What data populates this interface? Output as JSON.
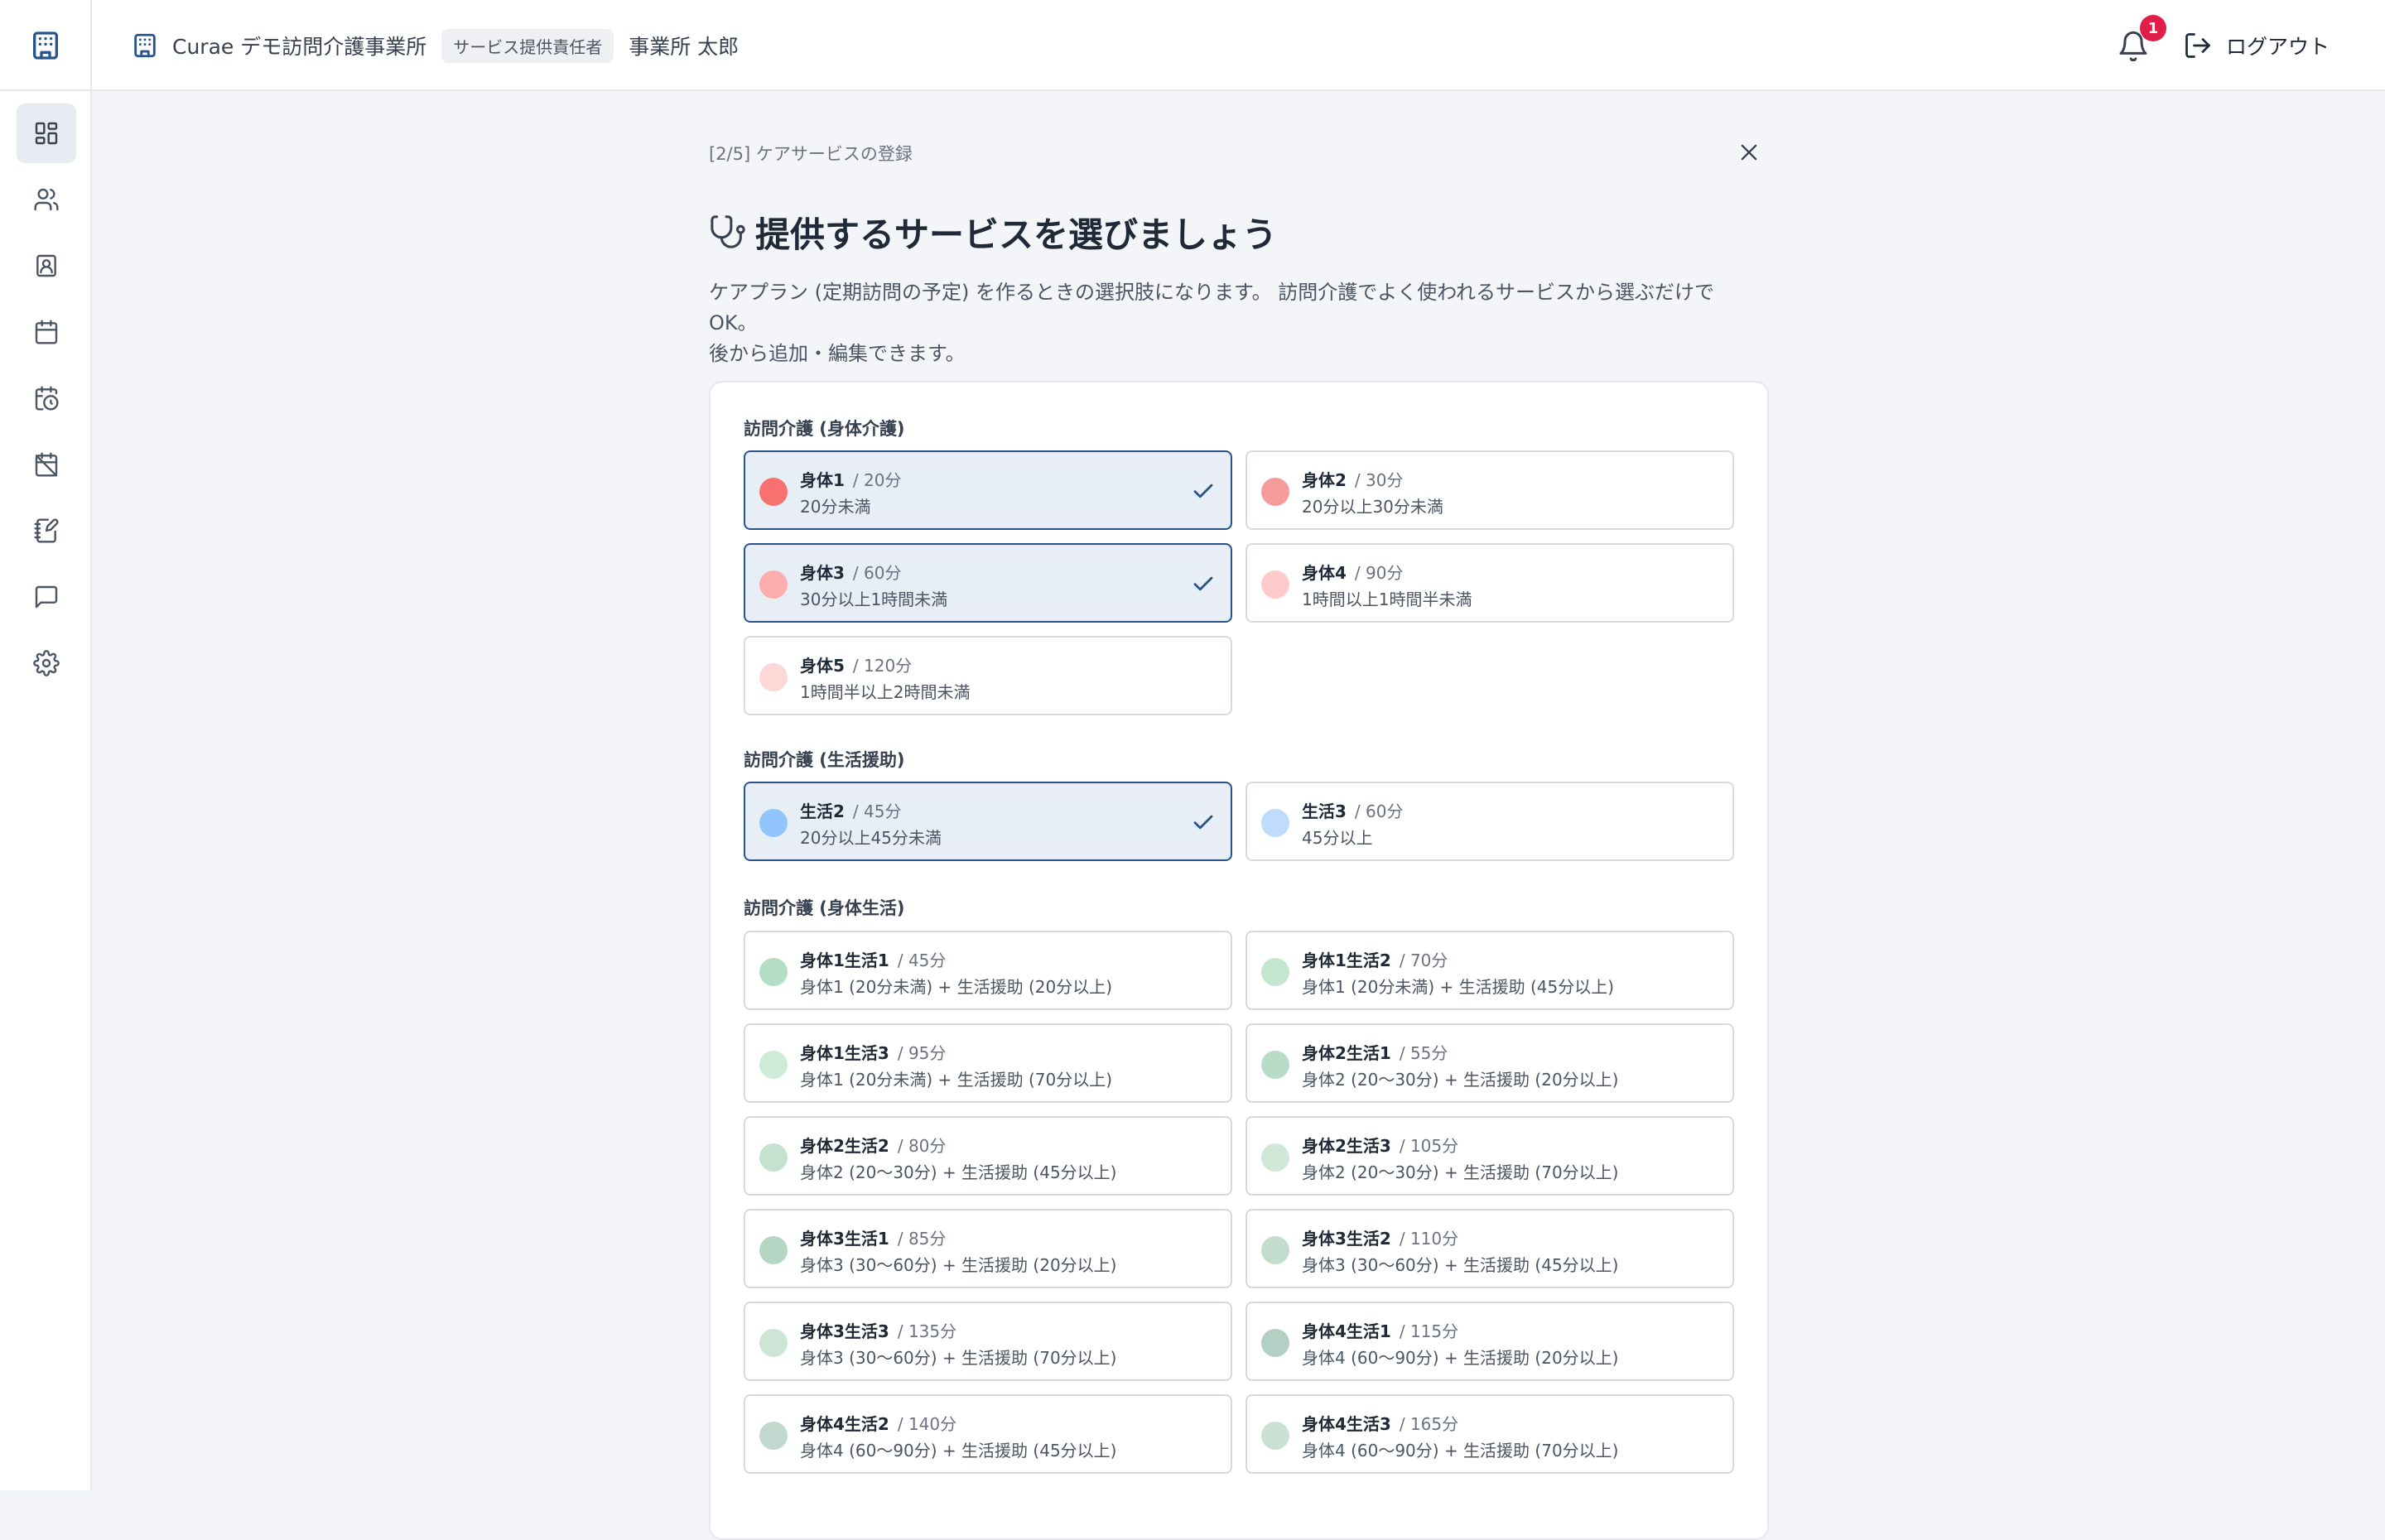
{
  "header": {
    "office_name": "Curae デモ訪問介護事業所",
    "role_badge": "サービス提供責任者",
    "user_name": "事業所 太郎",
    "notification_count": "1",
    "logout_label": "ログアウト"
  },
  "sidebar": {
    "items": [
      {
        "icon": "dashboard-icon",
        "active": true
      },
      {
        "icon": "users-icon",
        "active": false
      },
      {
        "icon": "contact-card-icon",
        "active": false
      },
      {
        "icon": "calendar-icon",
        "active": false
      },
      {
        "icon": "calendar-clock-icon",
        "active": false
      },
      {
        "icon": "calendar-off-icon",
        "active": false
      },
      {
        "icon": "notebook-edit-icon",
        "active": false
      },
      {
        "icon": "message-icon",
        "active": false
      },
      {
        "icon": "settings-icon",
        "active": false
      }
    ]
  },
  "wizard": {
    "step": "[2/5] ケアサービスの登録",
    "title": "提供するサービスを選びましょう",
    "desc_line1": "ケアプラン (定期訪問の予定) を作るときの選択肢になります。 訪問介護でよく使われるサービスから選ぶだけで OK。",
    "desc_line2": "後から追加・編集できます。"
  },
  "sections": [
    {
      "title": "訪問介護 (身体介護)",
      "services": [
        {
          "name": "身体1",
          "duration": "/ 20分",
          "desc": "20分未満",
          "color": "#f87171",
          "selected": true
        },
        {
          "name": "身体2",
          "duration": "/ 30分",
          "desc": "20分以上30分未満",
          "color": "#f59b9b",
          "selected": false
        },
        {
          "name": "身体3",
          "duration": "/ 60分",
          "desc": "30分以上1時間未満",
          "color": "#fcaeae",
          "selected": true
        },
        {
          "name": "身体4",
          "duration": "/ 90分",
          "desc": "1時間以上1時間半未満",
          "color": "#fecaca",
          "selected": false
        },
        {
          "name": "身体5",
          "duration": "/ 120分",
          "desc": "1時間半以上2時間未満",
          "color": "#fed7d7",
          "selected": false
        }
      ]
    },
    {
      "title": "訪問介護 (生活援助)",
      "services": [
        {
          "name": "生活2",
          "duration": "/ 45分",
          "desc": "20分以上45分未満",
          "color": "#93c5fd",
          "selected": true
        },
        {
          "name": "生活3",
          "duration": "/ 60分",
          "desc": "45分以上",
          "color": "#bfdbfe",
          "selected": false
        }
      ]
    },
    {
      "title": "訪問介護 (身体生活)",
      "services": [
        {
          "name": "身体1生活1",
          "duration": "/ 45分",
          "desc": "身体1 (20分未満) + 生活援助 (20分以上)",
          "color": "#b4dfc4",
          "selected": false
        },
        {
          "name": "身体1生活2",
          "duration": "/ 70分",
          "desc": "身体1 (20分未満) + 生活援助 (45分以上)",
          "color": "#c4e6cf",
          "selected": false
        },
        {
          "name": "身体1生活3",
          "duration": "/ 95分",
          "desc": "身体1 (20分未満) + 生活援助 (70分以上)",
          "color": "#cdebd6",
          "selected": false
        },
        {
          "name": "身体2生活1",
          "duration": "/ 55分",
          "desc": "身体2 (20〜30分) + 生活援助 (20分以上)",
          "color": "#b8dcc6",
          "selected": false
        },
        {
          "name": "身体2生活2",
          "duration": "/ 80分",
          "desc": "身体2 (20〜30分) + 生活援助 (45分以上)",
          "color": "#c4e2cf",
          "selected": false
        },
        {
          "name": "身体2生活3",
          "duration": "/ 105分",
          "desc": "身体2 (20〜30分) + 生活援助 (70分以上)",
          "color": "#cfe8d8",
          "selected": false
        },
        {
          "name": "身体3生活1",
          "duration": "/ 85分",
          "desc": "身体3 (30〜60分) + 生活援助 (20分以上)",
          "color": "#b5d6c4",
          "selected": false
        },
        {
          "name": "身体3生活2",
          "duration": "/ 110分",
          "desc": "身体3 (30〜60分) + 生活援助 (45分以上)",
          "color": "#c2ddce",
          "selected": false
        },
        {
          "name": "身体3生活3",
          "duration": "/ 135分",
          "desc": "身体3 (30〜60分) + 生活援助 (70分以上)",
          "color": "#cde5d7",
          "selected": false
        },
        {
          "name": "身体4生活1",
          "duration": "/ 115分",
          "desc": "身体4 (60〜90分) + 生活援助 (20分以上)",
          "color": "#b4d0c4",
          "selected": false
        },
        {
          "name": "身体4生活2",
          "duration": "/ 140分",
          "desc": "身体4 (60〜90分) + 生活援助 (45分以上)",
          "color": "#c0d8cd",
          "selected": false
        },
        {
          "name": "身体4生活3",
          "duration": "/ 165分",
          "desc": "身体4 (60〜90分) + 生活援助 (70分以上)",
          "color": "#cbe0d5",
          "selected": false
        }
      ]
    }
  ]
}
